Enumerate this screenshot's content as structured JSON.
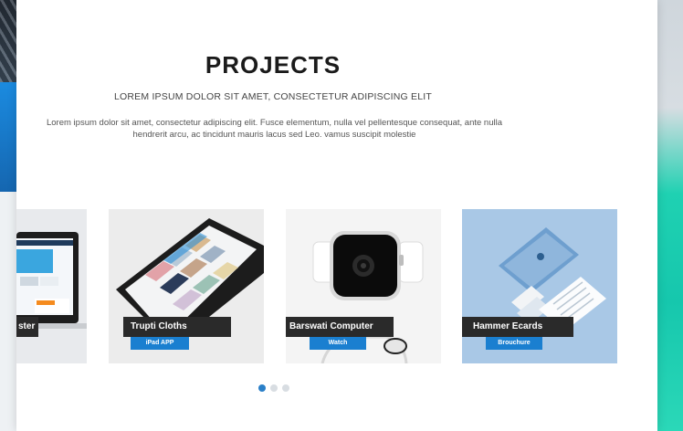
{
  "section": {
    "title": "PROJECTS",
    "subtitle": "LOREM IPSUM DOLOR SIT AMET, CONSECTETUR ADIPISCING ELIT",
    "description": "Lorem ipsum dolor sit amet, consectetur adipiscing elit. Fusce elementum, nulla vel pellentesque consequat, ante nulla hendrerit arcu, ac tincidunt mauris lacus sed Leo. vamus suscipit molestie"
  },
  "projects": [
    {
      "title": "ster",
      "tag": "",
      "image": "laptop-screen"
    },
    {
      "title": "Trupti Cloths",
      "tag": "iPad APP",
      "image": "tablet"
    },
    {
      "title": "Barswati Computer",
      "tag": "Watch",
      "image": "smartwatch"
    },
    {
      "title": "Hammer Ecards",
      "tag": "Brouchure",
      "image": "stationery"
    }
  ],
  "carousel": {
    "pages": 3,
    "active_page": 1
  },
  "colors": {
    "accent": "#1a7fd0",
    "label_bg": "#2a2a2a",
    "title": "#1b1b1b"
  }
}
